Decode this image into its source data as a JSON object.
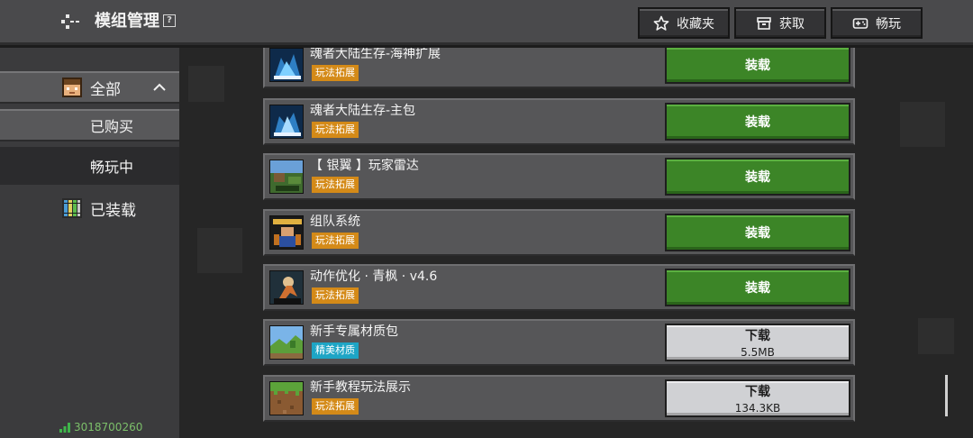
{
  "header": {
    "title": "模组管理",
    "help_glyph": "?",
    "buttons": [
      {
        "label": "收藏夹",
        "icon": "star-icon"
      },
      {
        "label": "获取",
        "icon": "chest-icon"
      },
      {
        "label": "畅玩",
        "icon": "gamepad-icon"
      }
    ]
  },
  "sidebar": {
    "items": [
      {
        "label": "全部",
        "icon": "character-icon"
      },
      {
        "label": "已购买"
      },
      {
        "label": "畅玩中"
      },
      {
        "label": "已装载",
        "icon": "books-icon"
      }
    ],
    "user_id": "3018700260"
  },
  "mods": [
    {
      "name": "魂者大陆生存-海神扩展",
      "tag": "玩法拓展",
      "action": "装载",
      "thumb": "soul-land-icon"
    },
    {
      "name": "魂者大陆生存-主包",
      "tag": "玩法拓展",
      "action": "装载",
      "thumb": "soul-land-icon"
    },
    {
      "name": "【 银翼 】玩家雷达",
      "tag": "玩法拓展",
      "action": "装载",
      "thumb": "radar-map-icon"
    },
    {
      "name": "组队系统",
      "tag": "玩法拓展",
      "action": "装载",
      "thumb": "party-system-icon"
    },
    {
      "name": "动作优化 · 青枫 · v4.6",
      "tag": "玩法拓展",
      "action": "装载",
      "thumb": "action-figure-icon"
    },
    {
      "name": "新手专属材质包",
      "tag": "精美材质",
      "action": "下载",
      "size": "5.5MB",
      "thumb": "landscape-icon"
    },
    {
      "name": "新手教程玩法展示",
      "tag": "玩法拓展",
      "action": "下载",
      "size": "134.3KB",
      "thumb": "dirt-block-icon"
    }
  ],
  "colors": {
    "install_green": "#3c8527",
    "tag_orange": "#d48a18",
    "tag_cyan": "#1ea5c5",
    "download_gray": "#d0d1d4"
  }
}
